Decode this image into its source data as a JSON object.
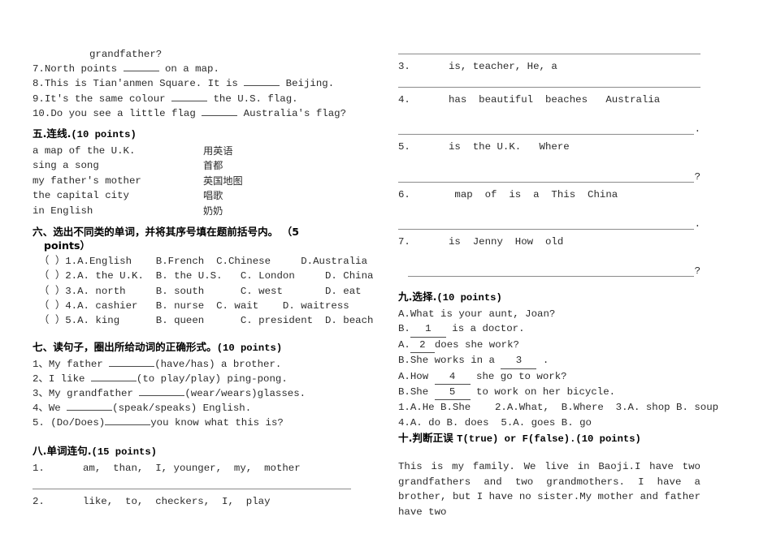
{
  "document": {
    "kind": "english-exam-worksheet",
    "language_mix": "Chinese instructions with English exercises"
  },
  "left_column": {
    "continued_fill_blank": {
      "carryover_line": "grandfather?",
      "items": [
        {
          "num": "7.",
          "before": "North points ",
          "blank": true,
          "after": " on a map."
        },
        {
          "num": "8.",
          "before": "This is Tian'anmen Square. It is ",
          "blank": true,
          "after": " Beijing."
        },
        {
          "num": "9.",
          "before": "It's the same colour ",
          "blank": true,
          "after": " the U.S. flag."
        },
        {
          "num": "10.",
          "before": "Do you see a little flag ",
          "blank": true,
          "after": " Australia's flag?"
        }
      ]
    },
    "section_five": {
      "heading": "五.连线.",
      "points": "(10 points)",
      "pairs": [
        {
          "english": "a map of the U.K.",
          "chinese": "用英语"
        },
        {
          "english": "sing a song",
          "chinese": "首都"
        },
        {
          "english": "my father's mother",
          "chinese": "英国地图"
        },
        {
          "english": "the capital city",
          "chinese": "唱歌"
        },
        {
          "english": "in English",
          "chinese": "奶奶"
        }
      ]
    },
    "section_six": {
      "heading_line1": "六、选出不同类的单词，并将其序号填在题前括号内。 （5",
      "heading_line2": "points）",
      "questions": [
        {
          "bracket": "（ ）",
          "num": "1.",
          "options": "A.English    B.French  C.Chinese     D.Australia"
        },
        {
          "bracket": "（ ）",
          "num": "2.",
          "options": "A. the U.K.  B. the U.S.   C. London     D. China"
        },
        {
          "bracket": "（ ）",
          "num": "3.",
          "options": "A. north     B. south      C. west       D. eat"
        },
        {
          "bracket": "（ ）",
          "num": "4.",
          "options": "A. cashier   B. nurse  C. wait    D. waitress"
        },
        {
          "bracket": "（ ）",
          "num": "5.",
          "options": "A. king      B. queen      C. president  D. beach"
        }
      ]
    },
    "section_seven": {
      "heading": "七、读句子，圈出所给动词的正确形式。",
      "points": "(10 points)",
      "questions": [
        {
          "num": "1、",
          "before": "My father ",
          "after": "(have/has) a brother."
        },
        {
          "num": "2、",
          "before": "I like ",
          "after": "(to play/play) ping-pong."
        },
        {
          "num": "3、",
          "before": "My grandfather ",
          "after": "(wear/wears)glasses."
        },
        {
          "num": "4、",
          "before": "We ",
          "after": "(speak/speaks) English."
        },
        {
          "num": "5.",
          "before": " (Do/Does)",
          "after": "you know what this is?"
        }
      ]
    },
    "section_eight": {
      "heading": "八.单词连句.",
      "points": "(15 points)",
      "items": [
        {
          "num": "1.",
          "words": "am,  than,  I, younger,  my,  mother",
          "answer_rule": true,
          "tail": ""
        },
        {
          "num": "2.",
          "words": "like,  to,  checkers,  I,  play",
          "answer_rule": false,
          "tail": ""
        }
      ]
    }
  },
  "right_column": {
    "section_eight_continued": {
      "items": [
        {
          "num": "3.",
          "words": "is, teacher, He, a",
          "tail": "."
        },
        {
          "num": "4.",
          "words": "has  beautiful  beaches   Australia",
          "tail": "."
        },
        {
          "num": "5.",
          "words": "is  the U.K.   Where",
          "tail": "?"
        },
        {
          "num": "6.",
          "words": " map  of  is  a  This  China",
          "tail": "."
        },
        {
          "num": "7.",
          "words": "is  Jenny  How  old",
          "tail": "?"
        }
      ]
    },
    "section_nine": {
      "heading": "九.选择.",
      "points": "(10 points)",
      "dialogue": [
        {
          "speaker": "A.",
          "before": "What is your aunt, Joan?",
          "blank": "",
          "after": ""
        },
        {
          "speaker": "B.",
          "before": "",
          "blank": "1",
          "after": " is a doctor."
        },
        {
          "speaker": "A.",
          "before": "",
          "blank": "2",
          "after": "does she work?"
        },
        {
          "speaker": "B.",
          "before": "She works in a ",
          "blank": "3",
          "after": " ."
        },
        {
          "speaker": "A.",
          "before": "How ",
          "blank": "4",
          "after": " she go to work?"
        },
        {
          "speaker": "B.",
          "before": "She ",
          "blank": "5",
          "after": " to work on her bicycle."
        }
      ],
      "options_line1": "1.A.He B.She    2.A.What,  B.Where  3.A. shop B. soup",
      "options_line2": "4.A. do B. does  5.A. goes B. go"
    },
    "section_ten": {
      "heading": "十.判断正误 ",
      "heading_en": "T(true) or F(false).",
      "points": "(10 points)",
      "passage": "This  is  my  family.  We  live  in  Baoji.I  have  two grandfathers and two grandmothers.  I  have a  brother, but  I  have  no  sister.My  mother  and  father  have  two"
    }
  },
  "colors": {
    "text": "#2b2b2b",
    "heading": "#000000",
    "rule": "#8b8b8b",
    "blank": "#4a4a4a",
    "background": "#ffffff"
  }
}
